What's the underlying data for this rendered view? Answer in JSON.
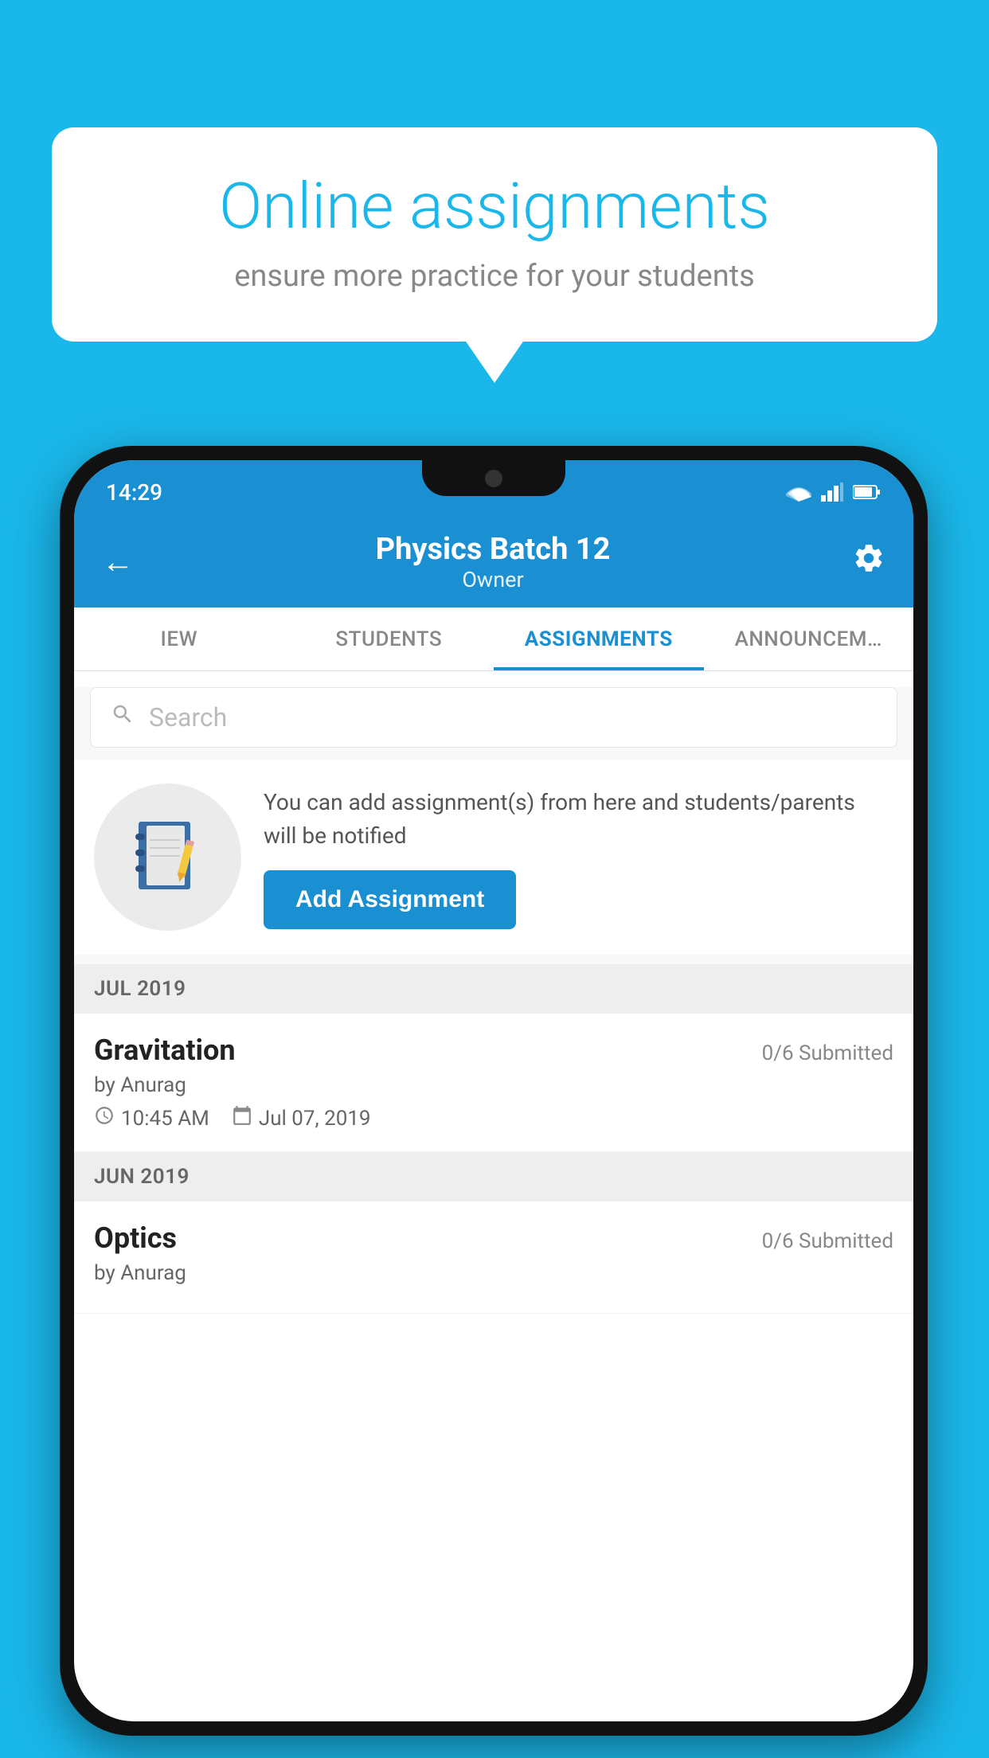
{
  "background_color": "#1ab7ea",
  "speech_bubble": {
    "title": "Online assignments",
    "subtitle": "ensure more practice for your students"
  },
  "status_bar": {
    "time": "14:29"
  },
  "header": {
    "title": "Physics Batch 12",
    "subtitle": "Owner"
  },
  "tabs": [
    {
      "label": "IEW",
      "active": false
    },
    {
      "label": "STUDENTS",
      "active": false
    },
    {
      "label": "ASSIGNMENTS",
      "active": true
    },
    {
      "label": "ANNOUNCEM…",
      "active": false
    }
  ],
  "search": {
    "placeholder": "Search"
  },
  "promo": {
    "text": "You can add assignment(s) from here and students/parents will be notified",
    "button_label": "Add Assignment"
  },
  "sections": [
    {
      "header": "JUL 2019",
      "assignments": [
        {
          "title": "Gravitation",
          "submitted": "0/6 Submitted",
          "by": "by Anurag",
          "time": "10:45 AM",
          "date": "Jul 07, 2019"
        }
      ]
    },
    {
      "header": "JUN 2019",
      "assignments": [
        {
          "title": "Optics",
          "submitted": "0/6 Submitted",
          "by": "by Anurag",
          "time": "",
          "date": ""
        }
      ]
    }
  ]
}
